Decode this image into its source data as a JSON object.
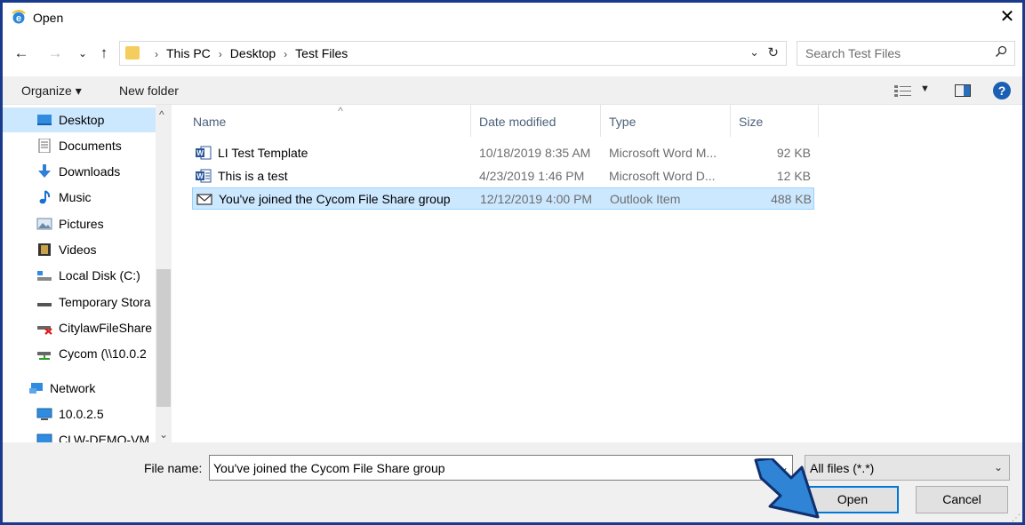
{
  "window": {
    "title": "Open",
    "close_glyph": "✕",
    "icon": "internet-explorer-icon"
  },
  "nav": {
    "back": "←",
    "forward": "→",
    "recent": "⌄",
    "up": "↑"
  },
  "address": {
    "crumbs": [
      "This PC",
      "Desktop",
      "Test Files"
    ],
    "dropdown": "⌄",
    "refresh": "↻"
  },
  "search": {
    "placeholder": "Search Test Files",
    "icon": "⚲"
  },
  "toolbar": {
    "organize": "Organize ▾",
    "new_folder": "New folder",
    "view_dd": "▼",
    "help": "?"
  },
  "sidebar": {
    "items": [
      {
        "label": "Desktop",
        "icon": "desktop-icon"
      },
      {
        "label": "Documents",
        "icon": "documents-icon"
      },
      {
        "label": "Downloads",
        "icon": "downloads-icon"
      },
      {
        "label": "Music",
        "icon": "music-icon"
      },
      {
        "label": "Pictures",
        "icon": "pictures-icon"
      },
      {
        "label": "Videos",
        "icon": "videos-icon"
      },
      {
        "label": "Local Disk (C:)",
        "icon": "local-disk-icon"
      },
      {
        "label": "Temporary Stora",
        "icon": "drive-icon"
      },
      {
        "label": "CitylawFileShare",
        "icon": "network-drive-disconnected-icon"
      },
      {
        "label": "Cycom (\\\\10.0.2",
        "icon": "network-drive-icon"
      },
      {
        "label": "Network",
        "icon": "network-icon"
      },
      {
        "label": "10.0.2.5",
        "icon": "computer-icon"
      },
      {
        "label": "CLW-DEMO-VM",
        "icon": "computer-icon"
      }
    ]
  },
  "columns": {
    "name": "Name",
    "date": "Date modified",
    "type": "Type",
    "size": "Size",
    "sort_glyph": "^"
  },
  "files": [
    {
      "name": "LI Test Template",
      "date": "10/18/2019 8:35 AM",
      "type": "Microsoft Word M...",
      "size": "92 KB",
      "icon": "word-template-icon"
    },
    {
      "name": "This is a test",
      "date": "4/23/2019 1:46 PM",
      "type": "Microsoft Word D...",
      "size": "12 KB",
      "icon": "word-document-icon"
    },
    {
      "name": "You've joined the Cycom File Share group",
      "date": "12/12/2019 4:00 PM",
      "type": "Outlook Item",
      "size": "488 KB",
      "icon": "mail-icon"
    }
  ],
  "footer": {
    "file_name_label": "File name:",
    "file_name_value": "You've joined the Cycom File Share group",
    "filter_value": "All files (*.*)",
    "open_label": "Open",
    "cancel_label": "Cancel",
    "dd": "⌄"
  },
  "colors": {
    "frame": "#1a3a8c",
    "selection": "#cce8ff",
    "arrow": "#2f84d6"
  }
}
